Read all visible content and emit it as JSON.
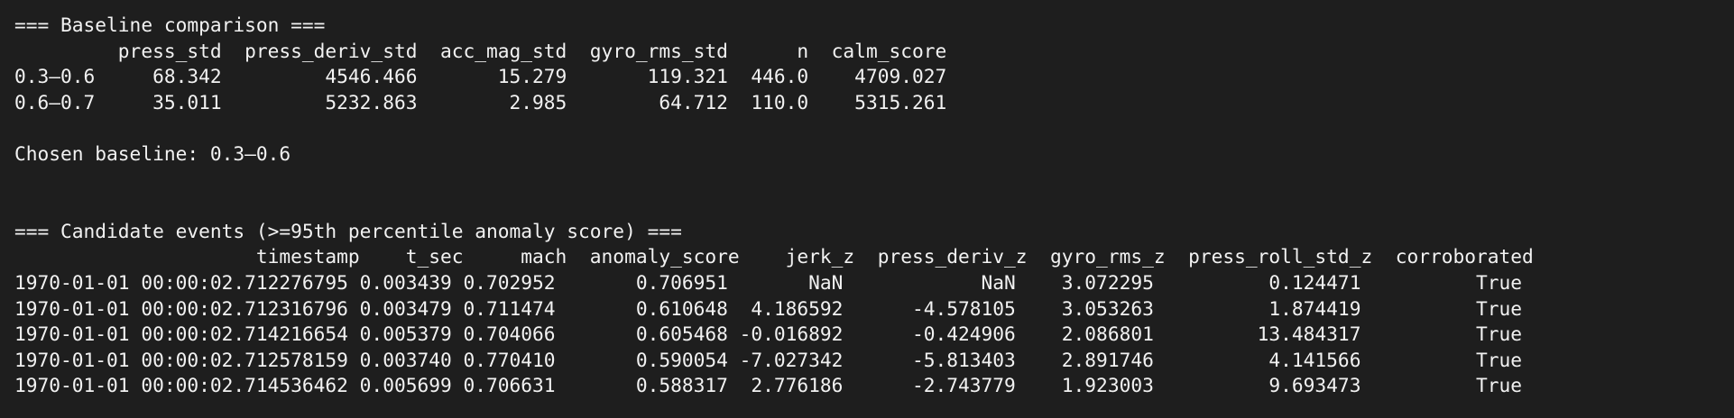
{
  "theme": {
    "background": "#1e1e1e",
    "foreground": "#f2f2f2"
  },
  "terminal": {
    "lines": [
      "=== Baseline comparison ===",
      "         press_std  press_deriv_std  acc_mag_std  gyro_rms_std      n  calm_score",
      "0.3–0.6     68.342         4546.466       15.279       119.321  446.0    4709.027",
      "0.6–0.7     35.011         5232.863        2.985        64.712  110.0    5315.261",
      "",
      "Chosen baseline: 0.3–0.6",
      "",
      "",
      "=== Candidate events (>=95th percentile anomaly score) ===",
      "                     timestamp    t_sec     mach  anomaly_score    jerk_z  press_deriv_z  gyro_rms_z  press_roll_std_z  corroborated",
      "1970-01-01 00:00:02.712276795 0.003439 0.702952       0.706951       NaN            NaN    3.072295          0.124471          True",
      "1970-01-01 00:00:02.712316796 0.003479 0.711474       0.610648  4.186592      -4.578105    3.053263          1.874419          True",
      "1970-01-01 00:00:02.714216654 0.005379 0.704066       0.605468 -0.016892      -0.424906    2.086801         13.484317          True",
      "1970-01-01 00:00:02.712578159 0.003740 0.770410       0.590054 -7.027342      -5.813403    2.891746          4.141566          True",
      "1970-01-01 00:00:02.714536462 0.005699 0.706631       0.588317  2.776186      -2.743779    1.923003          9.693473          True"
    ]
  }
}
